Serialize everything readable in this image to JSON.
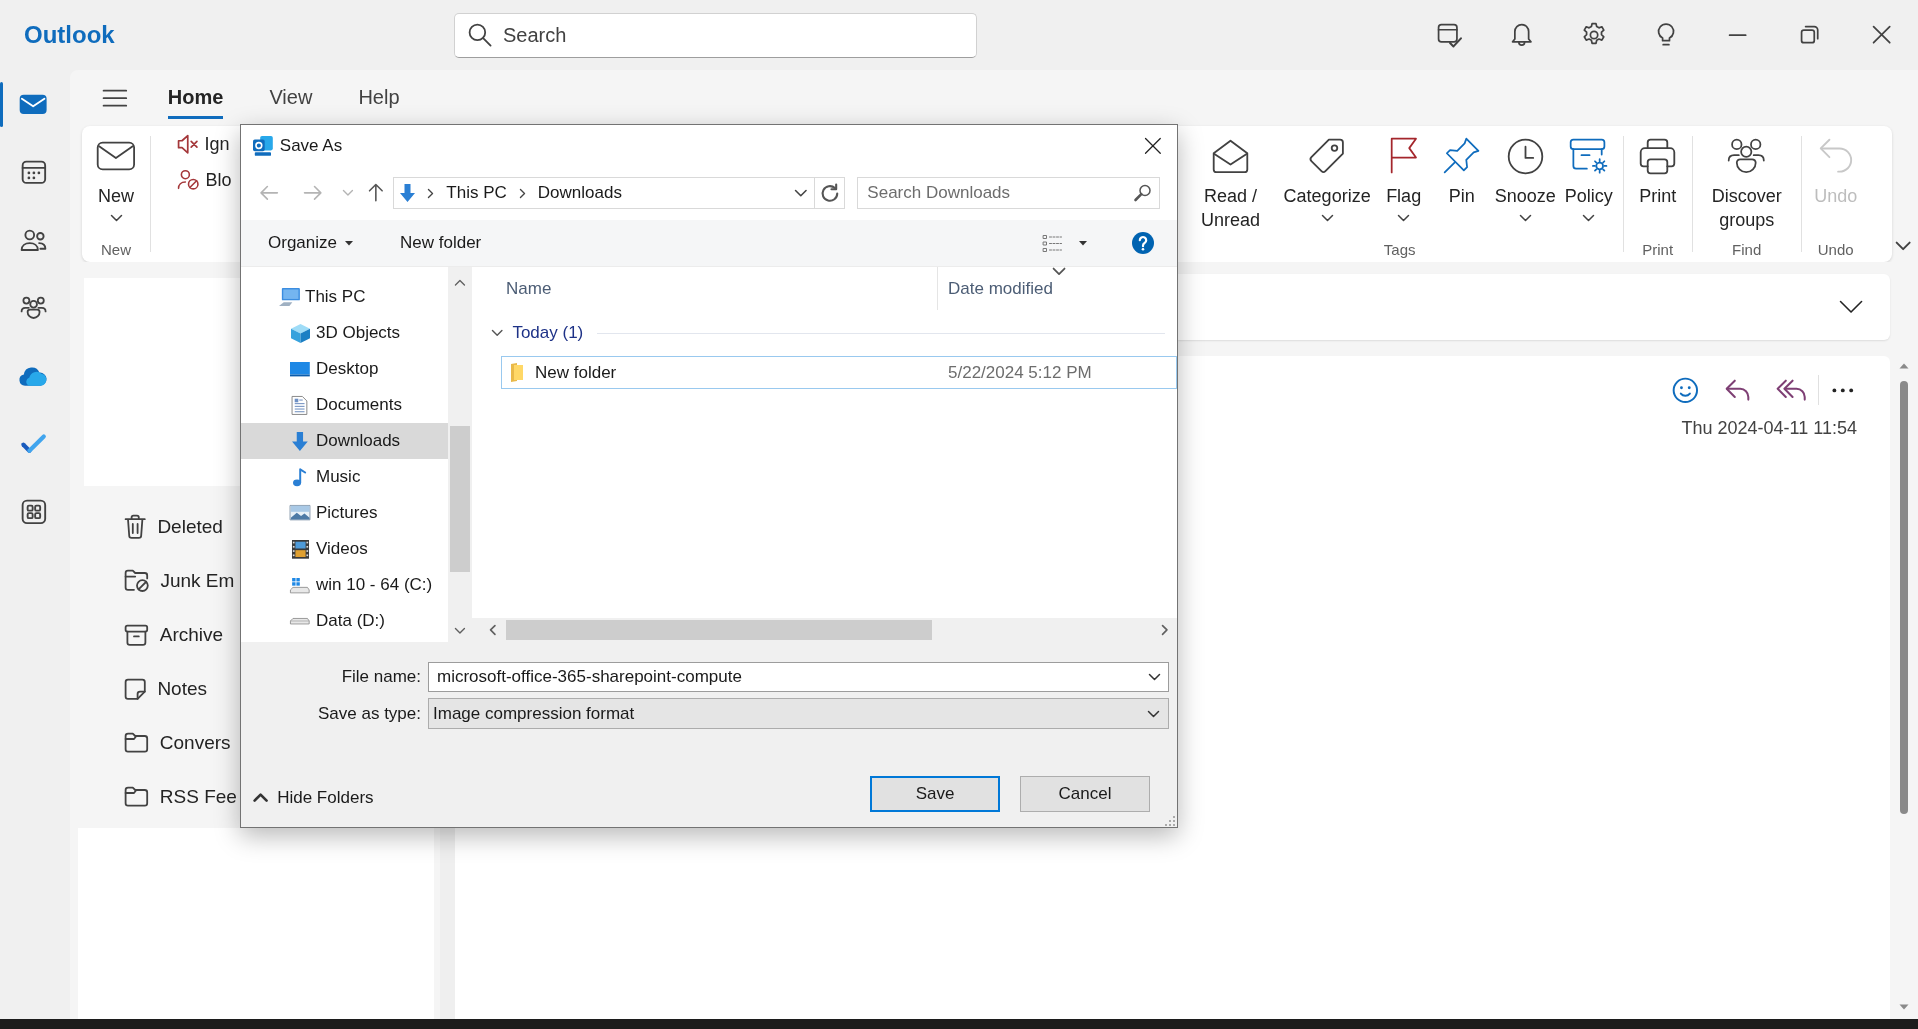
{
  "app": {
    "title": "Outlook"
  },
  "search": {
    "placeholder": "Search"
  },
  "nav_rail": [
    {
      "kind": "mail",
      "selected": true
    },
    {
      "kind": "calendar",
      "selected": false
    },
    {
      "kind": "people",
      "selected": false
    },
    {
      "kind": "groups",
      "selected": false
    },
    {
      "kind": "onedrive",
      "selected": false
    },
    {
      "kind": "todo",
      "selected": false
    },
    {
      "kind": "apps",
      "selected": false
    }
  ],
  "ribbon_tabs": [
    {
      "label": "Home",
      "selected": true
    },
    {
      "label": "View",
      "selected": false
    },
    {
      "label": "Help",
      "selected": false
    }
  ],
  "ribbon": {
    "groups": [
      {
        "label": "New",
        "kind": "large",
        "buttons": [
          {
            "label": "New",
            "kind": "new-mail",
            "dropdown": true,
            "disabled": false
          }
        ]
      },
      {
        "kind": "small",
        "buttons": [
          {
            "label": "Ign",
            "kind": "ignore",
            "disabled": false
          },
          {
            "label": "Blo",
            "kind": "block",
            "disabled": false
          }
        ]
      },
      {
        "label": "Tags",
        "kind": "large",
        "buttons": [
          {
            "label": "Read / Unread",
            "kind": "read-unread",
            "dropdown": false,
            "disabled": false
          },
          {
            "label": "Categorize",
            "kind": "categorize",
            "dropdown": true,
            "disabled": false
          },
          {
            "label": "Flag",
            "kind": "flag",
            "dropdown": true,
            "disabled": false
          },
          {
            "label": "Pin",
            "kind": "pin",
            "dropdown": false,
            "disabled": false
          },
          {
            "label": "Snooze",
            "kind": "snooze",
            "dropdown": true,
            "disabled": false
          },
          {
            "label": "Policy",
            "kind": "policy",
            "dropdown": true,
            "disabled": false
          }
        ]
      },
      {
        "label": "Print",
        "kind": "large",
        "buttons": [
          {
            "label": "Print",
            "kind": "print",
            "dropdown": false,
            "disabled": false
          }
        ]
      },
      {
        "label": "Find",
        "kind": "large",
        "buttons": [
          {
            "label": "Discover groups",
            "kind": "discover-groups",
            "dropdown": false,
            "disabled": false
          }
        ]
      },
      {
        "label": "Undo",
        "kind": "large",
        "buttons": [
          {
            "label": "Undo",
            "kind": "undo",
            "dropdown": false,
            "disabled": true
          }
        ]
      }
    ]
  },
  "folders": [
    {
      "label": "Deleted",
      "kind": "trash"
    },
    {
      "label": "Junk Em",
      "kind": "junk"
    },
    {
      "label": "Archive",
      "kind": "archive"
    },
    {
      "label": "Notes",
      "kind": "note"
    },
    {
      "label": "Convers",
      "kind": "folder"
    },
    {
      "label": "RSS Fee",
      "kind": "folder"
    }
  ],
  "reading_pane": {
    "date": "Thu 2024-04-11 11:54"
  },
  "dialog": {
    "title": "Save As",
    "address": {
      "path": [
        "This PC",
        "Downloads"
      ]
    },
    "search": {
      "placeholder": "Search Downloads"
    },
    "toolbar": [
      {
        "label": "Organize",
        "dropdown": true
      },
      {
        "label": "New folder",
        "dropdown": false
      }
    ],
    "nav": [
      {
        "label": "This PC",
        "kind": "pc",
        "selected": false,
        "children": [
          {
            "label": "3D Objects",
            "kind": "cube",
            "selected": false
          },
          {
            "label": "Desktop",
            "kind": "desktop",
            "selected": false
          },
          {
            "label": "Documents",
            "kind": "documents",
            "selected": false
          },
          {
            "label": "Downloads",
            "kind": "downloads",
            "selected": true
          },
          {
            "label": "Music",
            "kind": "music",
            "selected": false
          },
          {
            "label": "Pictures",
            "kind": "pictures",
            "selected": false
          },
          {
            "label": "Videos",
            "kind": "videos",
            "selected": false
          },
          {
            "label": "win 10 - 64 (C:)",
            "kind": "system-drive",
            "selected": false
          },
          {
            "label": "Data (D:)",
            "kind": "drive",
            "selected": false
          }
        ]
      }
    ],
    "columns": [
      {
        "label": "Name",
        "sorted": false
      },
      {
        "label": "Date modified",
        "sorted": true
      }
    ],
    "groups": [
      {
        "label": "Today (1)",
        "expanded": true,
        "rows": [
          {
            "name": "New folder",
            "date_modified": "5/22/2024 5:12 PM",
            "focused": true
          }
        ]
      }
    ],
    "file_name": {
      "label": "File name:",
      "value": "microsoft-office-365-sharepoint-compute"
    },
    "save_as_type": {
      "label": "Save as type:",
      "value": "Image compression format"
    },
    "hide_folders": "Hide Folders",
    "buttons": [
      {
        "label": "Save",
        "default": true
      },
      {
        "label": "Cancel",
        "default": false
      }
    ]
  }
}
